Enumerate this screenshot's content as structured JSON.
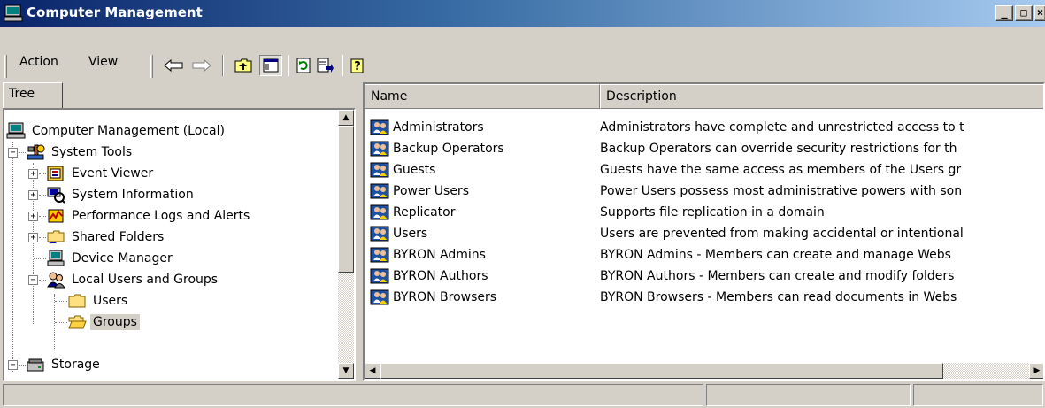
{
  "window": {
    "title": "Computer Management"
  },
  "menu": {
    "action": "Action",
    "view": "View"
  },
  "tree": {
    "tab_label": "Tree",
    "items": [
      {
        "label": "Computer Management (Local)",
        "icon": "computer-icon"
      },
      {
        "label": "System Tools",
        "icon": "system-tools-icon"
      },
      {
        "label": "Event Viewer",
        "icon": "event-viewer-icon"
      },
      {
        "label": "System Information",
        "icon": "system-information-icon"
      },
      {
        "label": "Performance Logs and Alerts",
        "icon": "performance-icon"
      },
      {
        "label": "Shared Folders",
        "icon": "shared-folder-icon"
      },
      {
        "label": "Device Manager",
        "icon": "device-manager-icon"
      },
      {
        "label": "Local Users and Groups",
        "icon": "users-groups-icon"
      },
      {
        "label": "Users",
        "icon": "folder-icon"
      },
      {
        "label": "Groups",
        "icon": "open-folder-icon"
      },
      {
        "label": "Storage",
        "icon": "storage-icon"
      }
    ]
  },
  "list": {
    "columns": [
      "Name",
      "Description"
    ],
    "rows": [
      {
        "name": "Administrators",
        "description": "Administrators have complete and unrestricted access to t"
      },
      {
        "name": "Backup Operators",
        "description": "Backup Operators can override security restrictions for th"
      },
      {
        "name": "Guests",
        "description": "Guests have the same access as members of the Users gr"
      },
      {
        "name": "Power Users",
        "description": "Power Users possess most administrative powers with son"
      },
      {
        "name": "Replicator",
        "description": "Supports file replication in a domain"
      },
      {
        "name": "Users",
        "description": "Users are prevented from making accidental or intentional"
      },
      {
        "name": "BYRON Admins",
        "description": "BYRON Admins - Members can create and manage Webs"
      },
      {
        "name": "BYRON Authors",
        "description": "BYRON Authors - Members can create and modify folders"
      },
      {
        "name": "BYRON Browsers",
        "description": "BYRON Browsers - Members can read documents in Webs"
      }
    ]
  },
  "colors": {
    "titlebar_start": "#0a246a",
    "titlebar_end": "#a6caf0",
    "face": "#d4d0c8"
  }
}
